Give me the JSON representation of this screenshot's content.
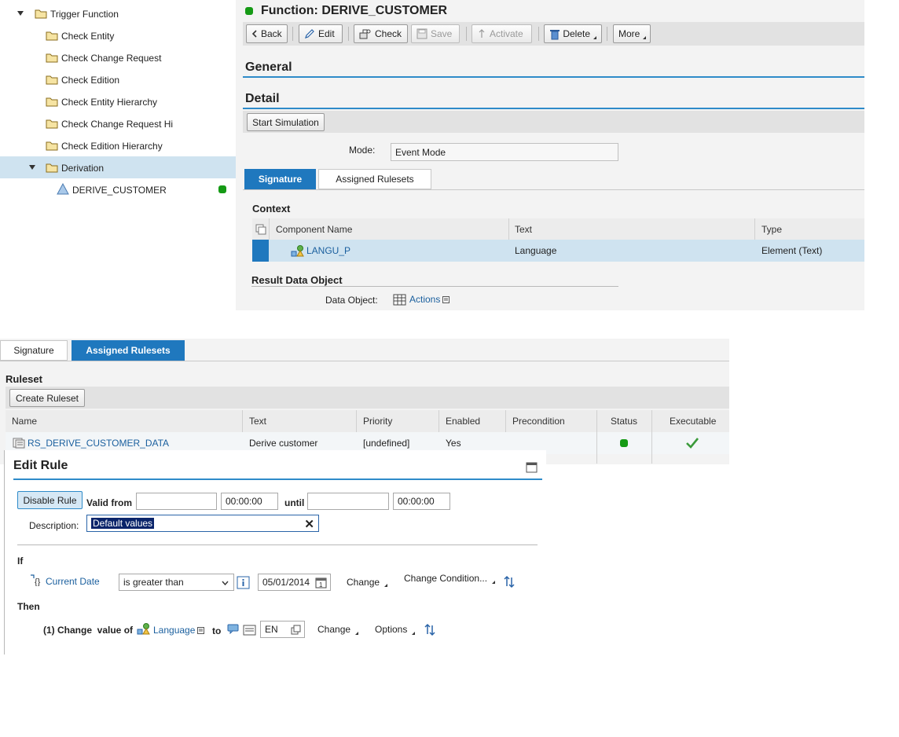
{
  "tree": {
    "items": [
      {
        "label": "Trigger Function",
        "level": 1,
        "expanded": true
      },
      {
        "label": "Check Entity",
        "level": 2
      },
      {
        "label": "Check Change Request",
        "level": 2
      },
      {
        "label": "Check Edition",
        "level": 2
      },
      {
        "label": "Check Entity Hierarchy",
        "level": 2
      },
      {
        "label": "Check Change Request Hi",
        "level": 2
      },
      {
        "label": "Check Edition Hierarchy",
        "level": 2
      },
      {
        "label": "Derivation",
        "level": 2,
        "expanded": true,
        "selected": true
      },
      {
        "label": "DERIVE_CUSTOMER",
        "level": 3,
        "status": "active"
      }
    ]
  },
  "function": {
    "title": "Function: DERIVE_CUSTOMER",
    "status_color": "#159a15",
    "toolbar": {
      "back": "Back",
      "edit": "Edit",
      "check": "Check",
      "save": "Save",
      "activate": "Activate",
      "delete": "Delete",
      "more": "More"
    },
    "general_title": "General",
    "detail_title": "Detail",
    "start_simulation": "Start Simulation",
    "mode_label": "Mode:",
    "mode_value": "Event Mode",
    "tabs": [
      "Signature",
      "Assigned Rulesets"
    ],
    "context_title": "Context",
    "context_columns": [
      "Component Name",
      "Text",
      "Type"
    ],
    "context_rows": [
      {
        "name": "LANGU_P",
        "text": "Language",
        "type": "Element (Text)"
      }
    ],
    "result_title": "Result Data Object",
    "data_object_label": "Data Object:",
    "data_object_value": "Actions"
  },
  "rulesets": {
    "tabs": [
      "Signature",
      "Assigned Rulesets"
    ],
    "title": "Ruleset",
    "create_button": "Create Ruleset",
    "columns": [
      "Name",
      "Text",
      "Priority",
      "Enabled",
      "Precondition",
      "Status",
      "Executable"
    ],
    "rows": [
      {
        "name": "RS_DERIVE_CUSTOMER_DATA",
        "text": "Derive customer",
        "priority": "[undefined]",
        "enabled": "Yes",
        "precondition": "",
        "status": "active",
        "executable": true
      }
    ]
  },
  "edit_rule": {
    "title": "Edit Rule",
    "disable_button": "Disable Rule",
    "valid_from_label": "Valid from",
    "valid_from_date": "",
    "valid_from_time": "00:00:00",
    "until_label": "until",
    "until_date": "",
    "until_time": "00:00:00",
    "description_label": "Description:",
    "description_value": "Default values",
    "if_label": "If",
    "condition_field": "Current Date",
    "condition_operator": "is greater than",
    "condition_value": "05/01/2014",
    "change_label": "Change",
    "change_condition_label": "Change Condition...",
    "then_label": "Then",
    "action_prefix": "(1) Change  value of",
    "action_target": "Language",
    "action_to": "to",
    "action_value": "EN",
    "action_change_label": "Change",
    "options_label": "Options"
  }
}
